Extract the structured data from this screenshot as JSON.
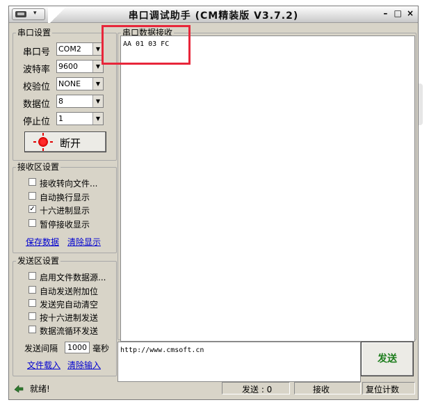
{
  "window": {
    "title": "串口调试助手 (CM精装版 V3.7.2)"
  },
  "window_controls": {
    "dropdown": "▾",
    "minimize": "–",
    "maximize": "□",
    "close": "×"
  },
  "port_settings": {
    "legend": "串口设置",
    "rows": [
      {
        "label": "串口号",
        "value": "COM2"
      },
      {
        "label": "波特率",
        "value": "9600"
      },
      {
        "label": "校验位",
        "value": "NONE"
      },
      {
        "label": "数据位",
        "value": "8"
      },
      {
        "label": "停止位",
        "value": "1"
      }
    ],
    "disconnect_label": "断开",
    "indicator_color": "#e00000"
  },
  "receive_settings": {
    "legend": "接收区设置",
    "options": [
      {
        "label": "接收转向文件...",
        "checked": false
      },
      {
        "label": "自动换行显示",
        "checked": false
      },
      {
        "label": "十六进制显示",
        "checked": true
      },
      {
        "label": "暂停接收显示",
        "checked": false
      }
    ],
    "save_link": "保存数据",
    "clear_link": "清除显示"
  },
  "send_settings": {
    "legend": "发送区设置",
    "options": [
      {
        "label": "启用文件数据源...",
        "checked": false
      },
      {
        "label": "自动发送附加位",
        "checked": false
      },
      {
        "label": "发送完自动清空",
        "checked": false
      },
      {
        "label": "按十六进制发送",
        "checked": false
      },
      {
        "label": "数据流循环发送",
        "checked": false
      }
    ],
    "interval_label": "发送间隔",
    "interval_value": "1000",
    "interval_unit": "毫秒",
    "load_link": "文件载入",
    "clear_input_link": "清除输入"
  },
  "receive_area": {
    "legend": "串口数据接收",
    "content": "AA 01 03 FC"
  },
  "send_area": {
    "content": "http://www.cmsoft.cn",
    "send_button": "发送"
  },
  "statusbar": {
    "status": "就绪!",
    "sent": "发送 : 0",
    "received": "接收",
    "reset_count": "复位计数"
  },
  "colors": {
    "annotation": "#e8263a",
    "send_button_text": "#1d7d1d",
    "link": "#0000d0"
  },
  "icons": {
    "status": "arrow-hand-icon",
    "indicator": "red-lamp-icon"
  }
}
